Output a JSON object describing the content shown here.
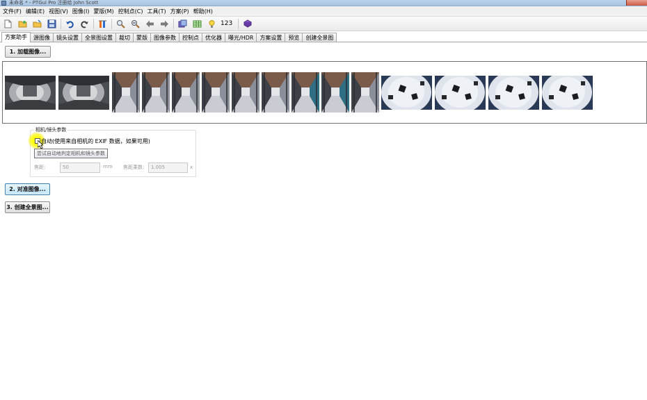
{
  "window": {
    "title": "未命名 * - PTGui Pro 注册给 John Scott"
  },
  "menu": [
    "文件(F)",
    "编辑(E)",
    "视图(V)",
    "图像(I)",
    "蒙版(M)",
    "控制点(C)",
    "工具(T)",
    "方案(P)",
    "帮助(H)"
  ],
  "toolbar": {
    "icons": [
      "new-file-icon",
      "open-folder-icon",
      "open-recent-icon",
      "save-icon",
      "undo-icon",
      "redo-icon",
      "panorama-editor-icon",
      "zoom-in-icon",
      "zoom-out-icon",
      "back-arrow-icon",
      "forward-arrow-icon",
      "batch-icon",
      "table-icon",
      "lightbulb-icon",
      "numbering-icon",
      "help-book-icon"
    ],
    "numbering_label": "123"
  },
  "tabs": [
    "方案助手",
    "源图像",
    "镜头设置",
    "全景图设置",
    "裁切",
    "蒙版",
    "图像参数",
    "控制点",
    "优化器",
    "曝光/HDR",
    "方案设置",
    "预览",
    "创建全景图"
  ],
  "active_tab_index": 0,
  "step1_button": "1. 加载图像...",
  "step2_button": "2. 对准图像...",
  "step3_button": "3. 创建全景图...",
  "lens_group": {
    "title": "相机/镜头参数",
    "auto_label": "自动(使用来自相机的 EXIF 数据，如果可用)",
    "tooltip": "尝试自动地判定相机和镜头参数",
    "focal_label": "焦距:",
    "focal_value": "50",
    "focal_unit": "mm",
    "multiplier_label": "焦距乘数:",
    "multiplier_value": "1.005",
    "multiplier_unit": "x"
  },
  "thumbnails": [
    {
      "kind": "wide",
      "scene": "interior-wide"
    },
    {
      "kind": "wide",
      "scene": "interior-wide"
    },
    {
      "kind": "tall",
      "scene": "corridor"
    },
    {
      "kind": "tall",
      "scene": "corridor"
    },
    {
      "kind": "tall",
      "scene": "corridor"
    },
    {
      "kind": "tall",
      "scene": "corridor"
    },
    {
      "kind": "tall",
      "scene": "corridor"
    },
    {
      "kind": "tall",
      "scene": "corridor"
    },
    {
      "kind": "tall",
      "scene": "corridor-blue"
    },
    {
      "kind": "tall",
      "scene": "corridor-blue"
    },
    {
      "kind": "tall",
      "scene": "corridor"
    },
    {
      "kind": "fish",
      "scene": "fisheye-ceiling"
    },
    {
      "kind": "fish",
      "scene": "fisheye-ceiling"
    },
    {
      "kind": "fish",
      "scene": "fisheye-ceiling"
    },
    {
      "kind": "fish",
      "scene": "fisheye-ceiling"
    }
  ]
}
